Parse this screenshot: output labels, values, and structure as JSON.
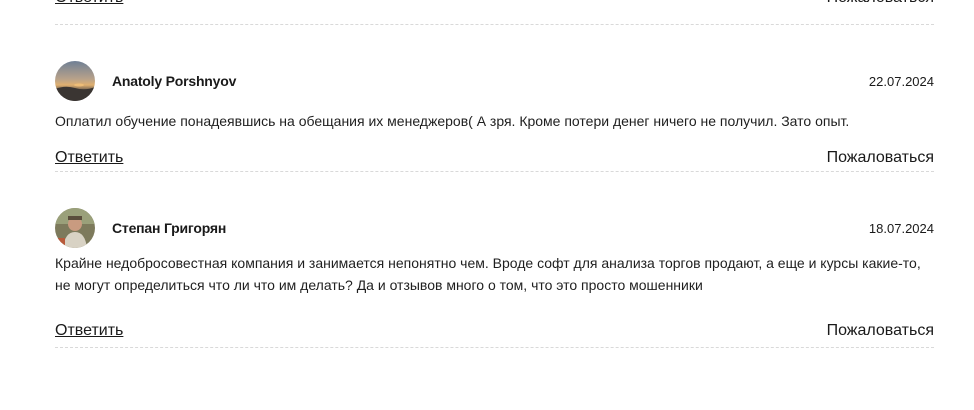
{
  "actions": {
    "reply_label": "Ответить",
    "report_label": "Пожаловаться"
  },
  "comments": [
    {
      "author": "Anatoly Porshnyov",
      "date": "22.07.2024",
      "text": "Оплатил обучение понадеявшись на обещания их менеджеров( А зря. Кроме потери денег ничего не получил. Зато опыт.",
      "avatar": "sunset-landscape-photo"
    },
    {
      "author": "Степан Григорян",
      "date": "18.07.2024",
      "text": "Крайне недобросовестная компания и занимается непонятно чем. Вроде софт для анализа торгов продают, а еще и курсы какие-то, не могут определиться что ли что им делать? Да и отзывов много о том, что это просто мошенники",
      "avatar": "person-outdoors-photo"
    }
  ],
  "colors": {
    "text": "#1f1f1f",
    "divider": "#d9d9d9",
    "background": "#ffffff"
  }
}
